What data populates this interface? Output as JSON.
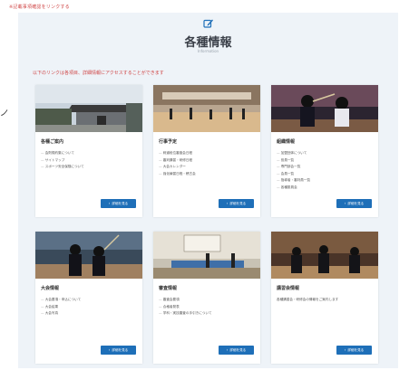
{
  "top_note": "※記載事項確認をリンクする",
  "header": {
    "title": "各種情報",
    "subtitle": "Information"
  },
  "notice": "以下のリンクは各項目、詳細情報にアクセスすることができます",
  "colors": {
    "accent": "#1e6fb8",
    "notice": "#d04848",
    "panel": "#eef3f8"
  },
  "icon": "edit-icon",
  "cards": [
    {
      "title": "各種ご案内",
      "items": [
        "会則規約集について",
        "サイトマップ",
        "スポーツ安全保険について"
      ],
      "button": "詳細を見る"
    },
    {
      "title": "行事予定",
      "items": [
        "剣道段位審査会日程",
        "審判講習・研修日程",
        "大会カレンダー",
        "強化練習日程・稽古会"
      ],
      "button": "詳細を見る"
    },
    {
      "title": "組織情報",
      "items": [
        "加盟団体について",
        "役員一覧",
        "専門部会一覧",
        "会員一覧",
        "指導者・審判員一覧",
        "各種委員会"
      ],
      "button": "詳細を見る"
    },
    {
      "title": "大会情報",
      "items": [
        "大会要項・申込について",
        "大会結果",
        "大会写真"
      ],
      "button": "詳細を見る"
    },
    {
      "title": "審査情報",
      "items": [
        "審査会要項",
        "合格者発表",
        "学科・実技審査の手引きについて"
      ],
      "button": "詳細を見る"
    },
    {
      "title": "講習会情報",
      "desc": "各種講習会・研修会の情報をご案内します",
      "button": "詳細を見る"
    }
  ]
}
